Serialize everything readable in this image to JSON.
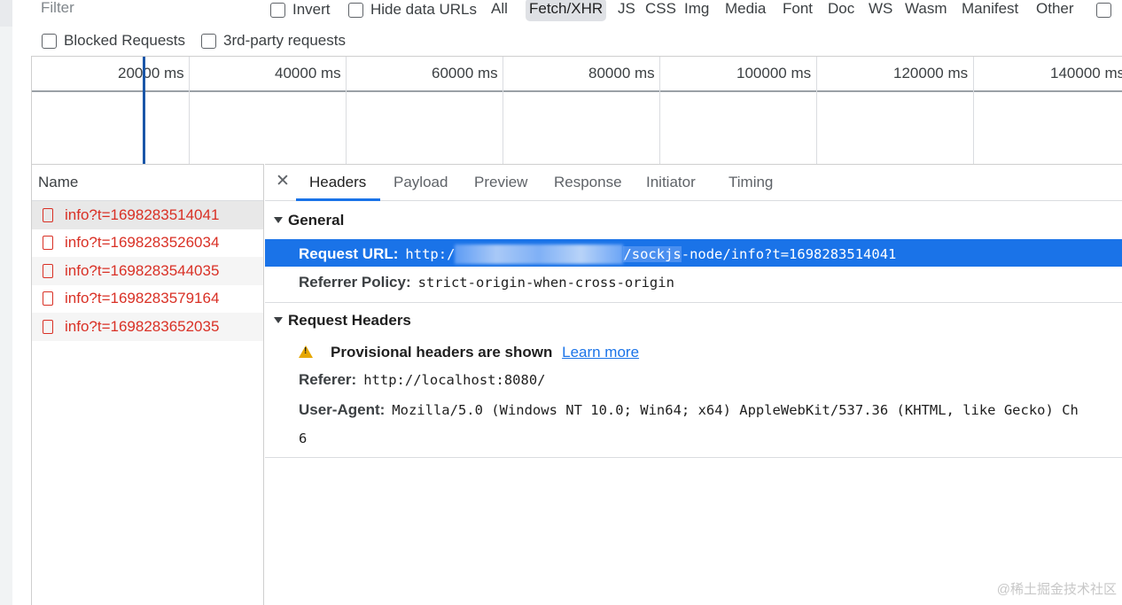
{
  "toolbar": {
    "filter_placeholder": "Filter",
    "invert": "Invert",
    "hide_data_urls": "Hide data URLs",
    "types": [
      "All",
      "Fetch/XHR",
      "JS",
      "CSS",
      "Img",
      "Media",
      "Font",
      "Doc",
      "WS",
      "Wasm",
      "Manifest",
      "Other"
    ],
    "active_type": "Fetch/XHR",
    "blocked_requests": "Blocked Requests",
    "third_party": "3rd-party requests"
  },
  "timeline": {
    "labels": [
      "20000 ms",
      "40000 ms",
      "60000 ms",
      "80000 ms",
      "100000 ms",
      "120000 ms",
      "140000 ms"
    ]
  },
  "requests": {
    "column": "Name",
    "items": [
      "info?t=1698283514041",
      "info?t=1698283526034",
      "info?t=1698283544035",
      "info?t=1698283579164",
      "info?t=1698283652035"
    ],
    "selected_index": 0
  },
  "details": {
    "tabs": [
      "Headers",
      "Payload",
      "Preview",
      "Response",
      "Initiator",
      "Timing"
    ],
    "active_tab": "Headers",
    "general": {
      "title": "General",
      "request_url_label": "Request URL:",
      "request_url_prefix": "http:/",
      "request_url_hl": "/sockjs",
      "request_url_suffix": "-node/info?t=1698283514041",
      "referrer_policy_label": "Referrer Policy:",
      "referrer_policy_value": "strict-origin-when-cross-origin"
    },
    "request_headers": {
      "title": "Request Headers",
      "warning": "Provisional headers are shown",
      "learn_more": "Learn more",
      "referer_label": "Referer:",
      "referer_value": "http://localhost:8080/",
      "user_agent_label": "User-Agent:",
      "user_agent_value": "Mozilla/5.0 (Windows NT 10.0; Win64; x64) AppleWebKit/537.36 (KHTML, like Gecko) Ch",
      "user_agent_wrap": "6"
    }
  },
  "watermark": "@稀土掘金技术社区",
  "colors": {
    "accent": "#1a73e8",
    "error": "#d93025",
    "warning": "#e6a700"
  }
}
